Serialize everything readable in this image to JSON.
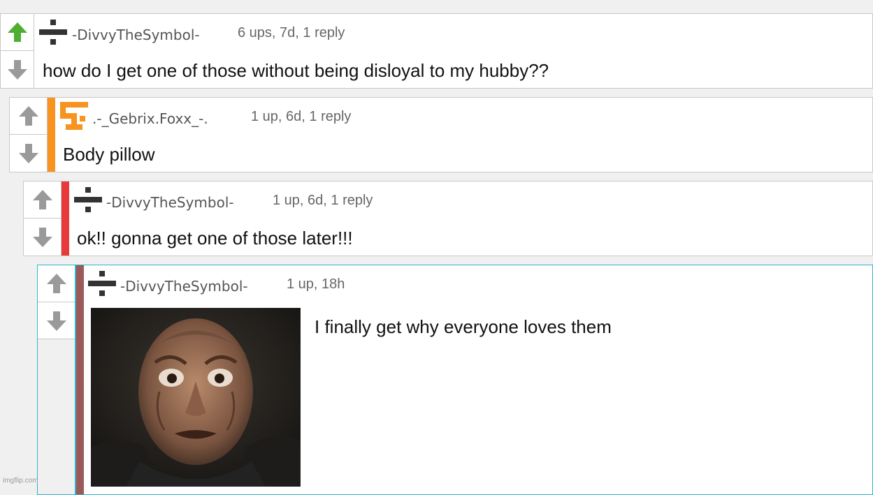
{
  "comments": [
    {
      "username": "-DivvyTheSymbol-",
      "meta": "6 ups, 7d, 1 reply",
      "text": "how do I get one of those without being disloyal to my hubby??",
      "avatar_icon": "divide-icon",
      "upvoted": true
    },
    {
      "username": ".-_Gebrix.Foxx_-.",
      "meta": "1 up, 6d, 1 reply",
      "text": "Body pillow",
      "avatar_icon": "orange-pixel-logo-icon",
      "stripe_color": "#f7931e"
    },
    {
      "username": "-DivvyTheSymbol-",
      "meta": "1 up, 6d, 1 reply",
      "text": "ok!! gonna get one of those later!!!",
      "avatar_icon": "divide-icon",
      "stripe_color": "#e83a3a"
    },
    {
      "username": "-DivvyTheSymbol-",
      "meta": "1 up, 18h",
      "text": "I finally get why everyone loves them",
      "avatar_icon": "divide-icon",
      "stripe_color": "#9a5a5a",
      "image_subject": "frightened-man-reaction-image"
    }
  ],
  "colors": {
    "upvote_active": "#4caf32",
    "vote_inactive": "#9a9a9a",
    "highlight_border": "#2fb5c8"
  },
  "watermark": "imgflip.com"
}
